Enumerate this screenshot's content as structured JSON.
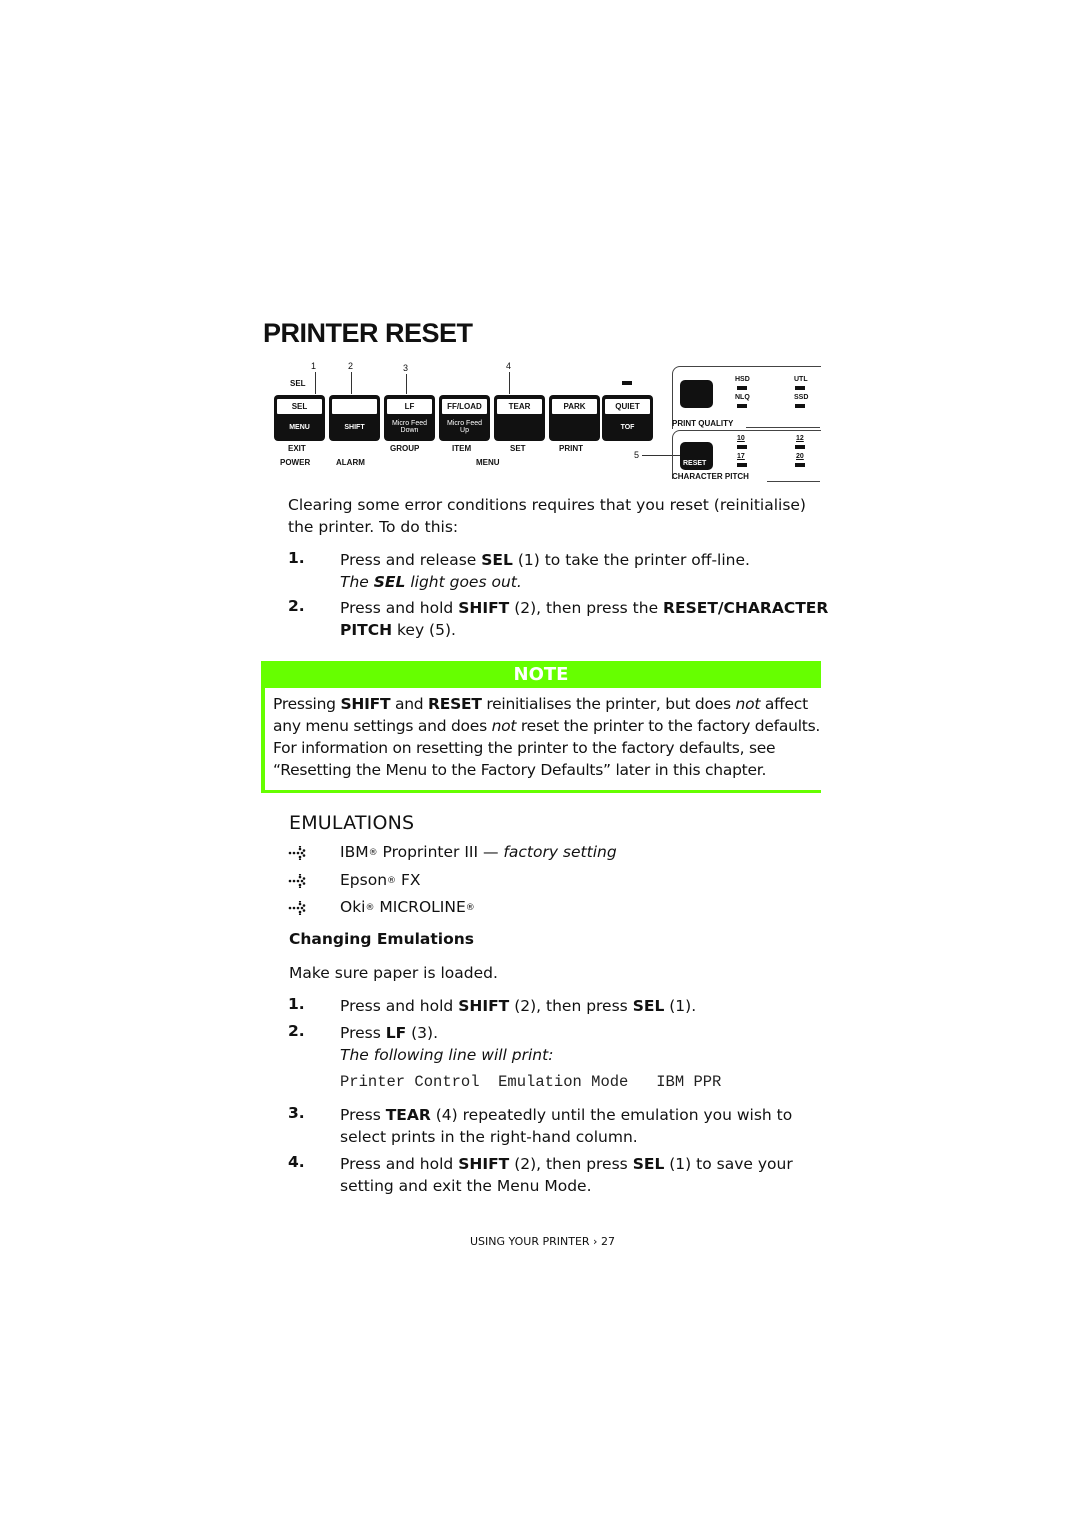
{
  "page": {
    "title": "PRINTER RESET",
    "footer": "USING YOUR PRINTER › 27"
  },
  "panel": {
    "callouts": [
      "1",
      "2",
      "3",
      "4",
      "5"
    ],
    "sel_indicator_label": "SEL",
    "keys": [
      {
        "top": "SEL",
        "bottom": "MENU",
        "below1": "EXIT",
        "below2": "POWER"
      },
      {
        "top": "",
        "bottom": "SHIFT",
        "below1": "",
        "below2": "ALARM"
      },
      {
        "top": "LF",
        "bottom_line1": "Micro Feed",
        "bottom_line2": "Down",
        "below1": "GROUP",
        "below2": ""
      },
      {
        "top": "FF/LOAD",
        "bottom_line1": "Micro Feed",
        "bottom_line2": "Up",
        "below1": "ITEM",
        "below2": ""
      },
      {
        "top": "TEAR",
        "bottom": "",
        "below1": "SET",
        "below2": ""
      },
      {
        "top": "PARK",
        "bottom": "",
        "below1": "PRINT",
        "below2": ""
      },
      {
        "top": "QUIET",
        "bottom": "TOF",
        "below1": "",
        "below2": ""
      }
    ],
    "menu_group_label": "MENU",
    "print_quality": {
      "label": "PRINT QUALITY",
      "options": [
        "HSD",
        "UTL",
        "NLQ",
        "SSD"
      ]
    },
    "character_pitch": {
      "label": "CHARACTER PITCH",
      "button": "RESET",
      "options": [
        "10",
        "12",
        "17",
        "20"
      ]
    }
  },
  "reset_section": {
    "intro": "Clearing some error conditions requires that you reset (reinitialise) the printer. To do this:",
    "steps": [
      {
        "num": "1.",
        "text_pre": "Press and release ",
        "bold": "SEL",
        "text_post": " (1) to take the printer off-line.",
        "result_pre": "The ",
        "result_bold": "SEL",
        "result_post": " light goes out."
      },
      {
        "num": "2.",
        "text_pre": "Press and hold ",
        "bold": "SHIFT",
        "text_mid": " (2), then press the ",
        "bold2": "RESET/CHARACTER",
        "bold3": "PITCH",
        "text_post": " key (5)."
      }
    ]
  },
  "note": {
    "header": "NOTE",
    "line1_pre": "Pressing ",
    "line1_b1": "SHIFT",
    "line1_mid": " and ",
    "line1_b2": "RESET",
    "line1_mid2": " reinitialises the printer, but does ",
    "line1_i": "not",
    "line1_post": " affect",
    "line2_pre": "any menu settings and does ",
    "line2_i": "not",
    "line2_post": " reset the printer to the factory defaults.",
    "line3": "For information on resetting the printer to the factory defaults, see",
    "line4": "“Resetting the Menu to the Factory Defaults” later in this chapter."
  },
  "emulations": {
    "heading": "EMULATIONS",
    "items": [
      {
        "name": "IBM",
        "reg": "®",
        "rest": " Proprinter III — ",
        "italic": "factory setting"
      },
      {
        "name": "Epson",
        "reg": "®",
        "rest": " FX",
        "italic": ""
      },
      {
        "name": "Oki",
        "reg": "®",
        "rest": " MICROLINE",
        "reg2": "®",
        "italic": ""
      }
    ],
    "subheading": "Changing Emulations",
    "intro": "Make sure paper is loaded.",
    "steps": [
      {
        "num": "1.",
        "pre": "Press and hold ",
        "b1": "SHIFT",
        "mid": " (2), then press ",
        "b2": "SEL",
        "post": " (1)."
      },
      {
        "num": "2.",
        "pre": "Press ",
        "b1": "LF",
        "post": " (3).",
        "result": "The following line will print:",
        "printout": "Printer Control  Emulation Mode   IBM PPR"
      },
      {
        "num": "3.",
        "pre": "Press ",
        "b1": "TEAR",
        "post": " (4) repeatedly until the emulation you wish to",
        "line2": "select prints in the right-hand column."
      },
      {
        "num": "4.",
        "pre": "Press and hold ",
        "b1": "SHIFT",
        "mid": " (2), then press ",
        "b2": "SEL",
        "post": " (1) to save your",
        "line2": "setting and exit the Menu Mode."
      }
    ]
  }
}
